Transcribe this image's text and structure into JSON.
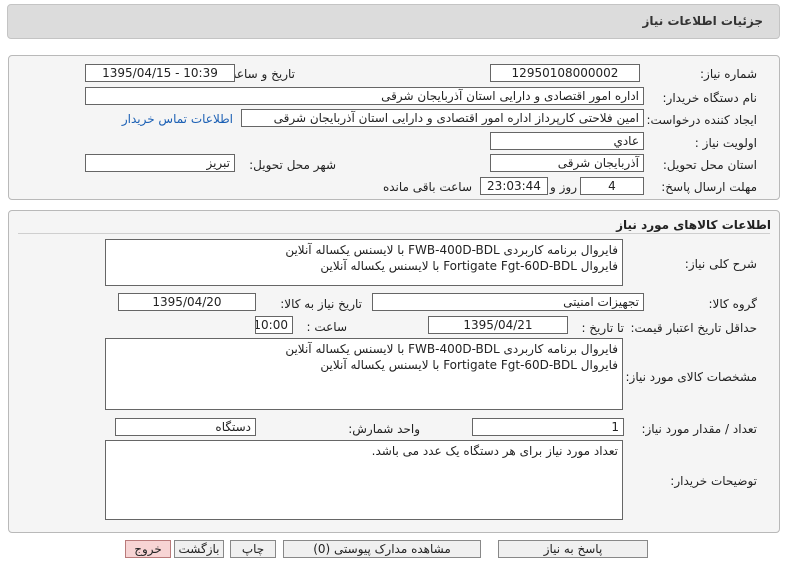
{
  "page": {
    "title": "جزئیات اطلاعات نیاز"
  },
  "details": {
    "need_number_label": "شماره نیاز:",
    "need_number": "12950108000002",
    "announce_label": "تاریخ و ساعت اعلان عمومی:",
    "announce_value": "1395/04/15 - 10:39",
    "buyer_org_label": "نام دستگاه خریدار:",
    "buyer_org": "اداره امور اقتصادی و دارایی استان آذربایجان شرقی",
    "creator_label": "ایجاد کننده درخواست:",
    "creator": "امین فلاحتی کارپرداز اداره امور اقتصادی و دارایی استان آذربایجان شرقی",
    "contact_link": "اطلاعات تماس خریدار",
    "priority_label": "اولویت نیاز :",
    "priority": "عادي",
    "province_label": "استان محل تحویل:",
    "province": "آذربایجان شرقی",
    "city_label": "شهر محل تحویل:",
    "city": "تبریز",
    "deadline_label": "مهلت ارسال پاسخ:",
    "days": "4",
    "days_suffix": "روز و",
    "time_left": "23:03:44",
    "time_left_suffix": "ساعت باقی مانده"
  },
  "goods": {
    "section_title": "اطلاعات کالاهای مورد نیاز",
    "summary_label": "شرح کلی نیاز:",
    "summary": "فایروال برنامه کاربردی FWB-400D-BDL با لایسنس یکساله آنلاین\nفایروال Fortigate Fgt-60D-BDL با لایسنس یکساله آنلاین",
    "group_label": "گروه کالا:",
    "group": "تجهیزات امنیتی",
    "need_date_label": "تاریخ نیاز به کالا:",
    "need_date": "1395/04/20",
    "validity_label": "حداقل تاریخ اعتبار قیمت:",
    "until_label": "تا تاریخ :",
    "validity_date": "1395/04/21",
    "hour_label": "ساعت :",
    "validity_time": "10:00",
    "specs_label": "مشخصات کالای مورد نیاز:",
    "specs": "فایروال برنامه کاربردی FWB-400D-BDL با لایسنس یکساله آنلاین\nفایروال Fortigate Fgt-60D-BDL با لایسنس یکساله آنلاین",
    "qty_label": "تعداد / مقدار مورد نیاز:",
    "qty": "1",
    "unit_label": "واحد شمارش:",
    "unit": "دستگاه",
    "buyer_notes_label": "توضیحات خریدار:",
    "buyer_notes": "تعداد مورد نیاز برای هر دستگاه یک عدد می باشد."
  },
  "buttons": {
    "reply": "پاسخ به نیاز",
    "attachments": "مشاهده مدارک پیوستی (0)",
    "print": "چاپ",
    "back": "بازگشت",
    "exit": "خروج"
  }
}
